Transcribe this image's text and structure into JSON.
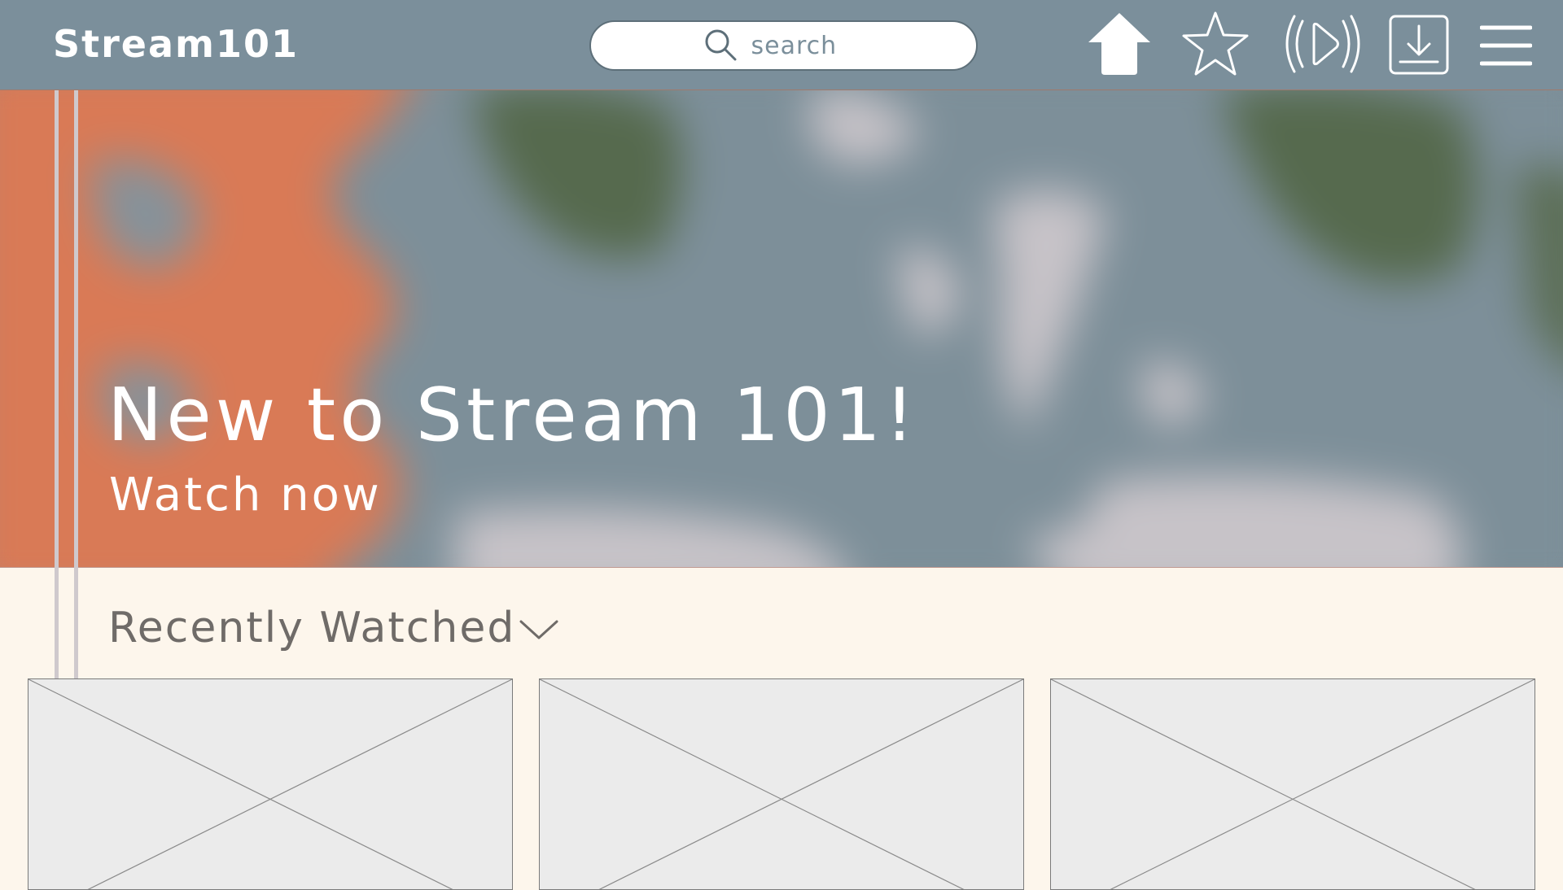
{
  "header": {
    "brand": "Stream101",
    "search": {
      "placeholder": "search"
    },
    "nav": [
      {
        "name": "home-icon",
        "label": "Home"
      },
      {
        "name": "star-icon",
        "label": "Favorites"
      },
      {
        "name": "live-play-icon",
        "label": "Live"
      },
      {
        "name": "download-icon",
        "label": "Downloads"
      },
      {
        "name": "hamburger-menu-icon",
        "label": "Menu"
      }
    ]
  },
  "hero": {
    "title": "New to Stream 101!",
    "cta": "Watch now"
  },
  "recently_watched": {
    "title": "Recently Watched",
    "toggle_icon": "chevron-down-icon",
    "items": [
      {
        "name": "placeholder-image"
      },
      {
        "name": "placeholder-image"
      },
      {
        "name": "placeholder-image"
      }
    ]
  },
  "colors": {
    "header_bg": "#7b8f9b",
    "page_bg": "#fdf6ec",
    "accent_orange": "#d97a56",
    "text_dark": "#6f6b68",
    "thumb_bg": "#ebebeb"
  }
}
